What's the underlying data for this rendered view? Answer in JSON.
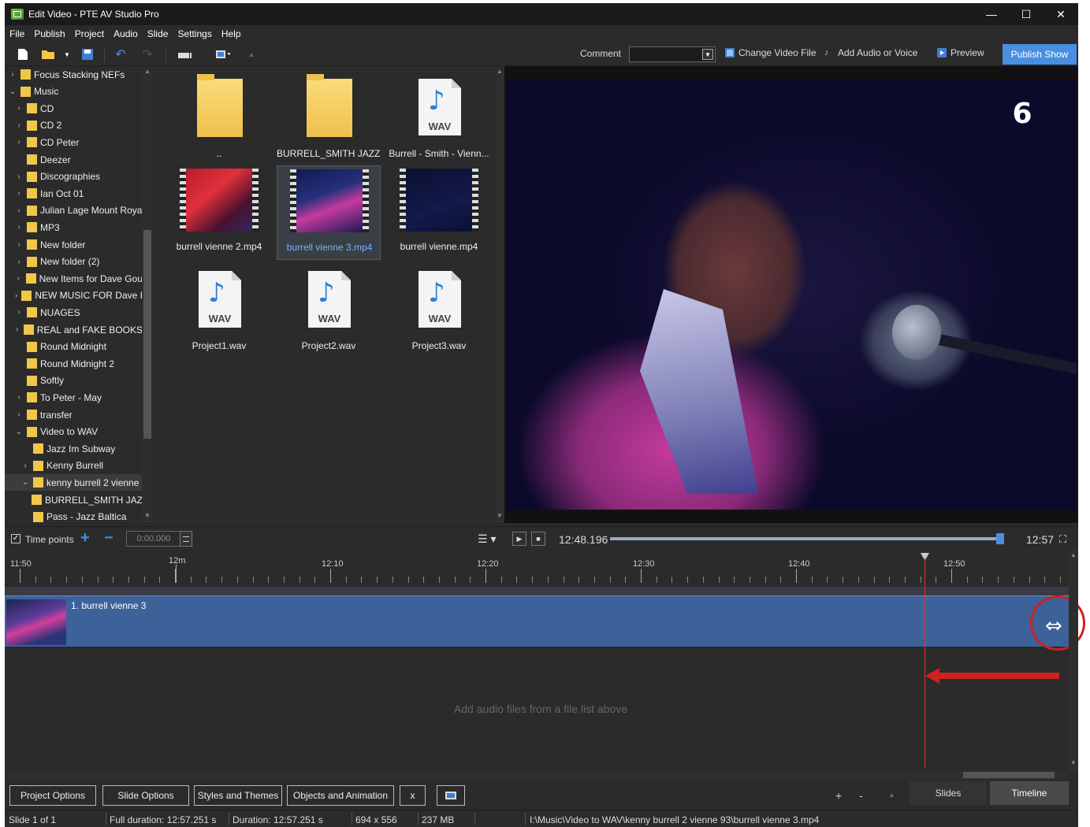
{
  "window": {
    "title": "Edit Video - PTE AV Studio Pro",
    "minimize": "—",
    "maximize": "☐",
    "close": "✕"
  },
  "menu": [
    "File",
    "Publish",
    "Project",
    "Audio",
    "Slide",
    "Settings",
    "Help"
  ],
  "toolbar": {
    "comment_label": "Comment",
    "comment_value": "",
    "change_video": "Change Video File",
    "add_audio": "Add Audio or Voice",
    "preview": "Preview",
    "publish": "Publish Show"
  },
  "tree": [
    {
      "label": "Focus Stacking NEFs",
      "arrow": ">",
      "indent": 0
    },
    {
      "label": "Music",
      "arrow": "v",
      "indent": 0
    },
    {
      "label": "CD",
      "arrow": ">",
      "indent": 1
    },
    {
      "label": "CD 2",
      "arrow": ">",
      "indent": 1
    },
    {
      "label": "CD Peter",
      "arrow": ">",
      "indent": 1
    },
    {
      "label": "Deezer",
      "arrow": "",
      "indent": 1
    },
    {
      "label": "Discographies",
      "arrow": ">",
      "indent": 1
    },
    {
      "label": "Ian Oct 01",
      "arrow": ">",
      "indent": 1
    },
    {
      "label": "Julian Lage Mount Roya",
      "arrow": ">",
      "indent": 1
    },
    {
      "label": "MP3",
      "arrow": ">",
      "indent": 1
    },
    {
      "label": "New folder",
      "arrow": ">",
      "indent": 1
    },
    {
      "label": "New folder (2)",
      "arrow": ">",
      "indent": 1
    },
    {
      "label": "New Items for Dave Gou",
      "arrow": ">",
      "indent": 1
    },
    {
      "label": "NEW MUSIC FOR Dave I",
      "arrow": ">",
      "indent": 1
    },
    {
      "label": "NUAGES",
      "arrow": ">",
      "indent": 1
    },
    {
      "label": "REAL and FAKE BOOKS",
      "arrow": ">",
      "indent": 1
    },
    {
      "label": "Round Midnight",
      "arrow": "",
      "indent": 1
    },
    {
      "label": "Round Midnight 2",
      "arrow": "",
      "indent": 1
    },
    {
      "label": "Softly",
      "arrow": "",
      "indent": 1
    },
    {
      "label": "To Peter - May",
      "arrow": ">",
      "indent": 1
    },
    {
      "label": "transfer",
      "arrow": ">",
      "indent": 1
    },
    {
      "label": "Video to WAV",
      "arrow": "v",
      "indent": 1
    },
    {
      "label": "Jazz Im Subway",
      "arrow": "",
      "indent": 2
    },
    {
      "label": "Kenny Burrell",
      "arrow": ">",
      "indent": 2
    },
    {
      "label": "kenny burrell 2 vienne",
      "arrow": "v",
      "indent": 2,
      "selected": true
    },
    {
      "label": "BURRELL_SMITH JAZ",
      "arrow": "",
      "indent": 3
    },
    {
      "label": "Pass - Jazz Baltica",
      "arrow": "",
      "indent": 2
    }
  ],
  "files": [
    {
      "name": "..",
      "type": "folder"
    },
    {
      "name": "BURRELL_SMITH JAZZ ...",
      "type": "folder"
    },
    {
      "name": "Burrell - Smith - Vienn...",
      "type": "wav"
    },
    {
      "name": "burrell vienne 2.mp4",
      "type": "video"
    },
    {
      "name": "burrell vienne 3.mp4",
      "type": "video",
      "selected": true
    },
    {
      "name": "burrell vienne.mp4",
      "type": "video"
    },
    {
      "name": "Project1.wav",
      "type": "wav"
    },
    {
      "name": "Project2.wav",
      "type": "wav"
    },
    {
      "name": "Project3.wav",
      "type": "wav"
    }
  ],
  "wav_badge": "WAV",
  "preview_logo": "6",
  "transport": {
    "timepoints_label": "Time points",
    "timepoints_checked": true,
    "time_value": "0:00.000",
    "current_time": "12:48.196",
    "end_time": "12:57",
    "seek_fraction": 0.99
  },
  "ruler_labels": [
    "11:50",
    "12m",
    "12:10",
    "12:20",
    "12:30",
    "12:40",
    "12:50"
  ],
  "clip": {
    "label": "1. burrell vienne 3"
  },
  "audio_hint": "Add audio files from a file list above",
  "buttons": [
    "Project Options",
    "Slide Options",
    "Styles and Themes",
    "Objects and Animation",
    "x"
  ],
  "zoom_controls": {
    "plus": "+",
    "minus": "-",
    "up": "▲"
  },
  "view_tabs": {
    "slides": "Slides",
    "timeline": "Timeline"
  },
  "status": {
    "slide": "Slide 1 of 1",
    "full_duration": "Full duration: 12:57.251 s",
    "duration": "Duration: 12:57.251 s",
    "resolution": "694 x 556",
    "size": "237 MB",
    "path": "I:\\Music\\Video to WAV\\kenny burrell 2 vienne 93\\burrell vienne 3.mp4"
  },
  "colors": {
    "accent": "#4a8fdf",
    "playhead": "#e03030",
    "track": "#3d6299",
    "annotation": "#d02020"
  }
}
